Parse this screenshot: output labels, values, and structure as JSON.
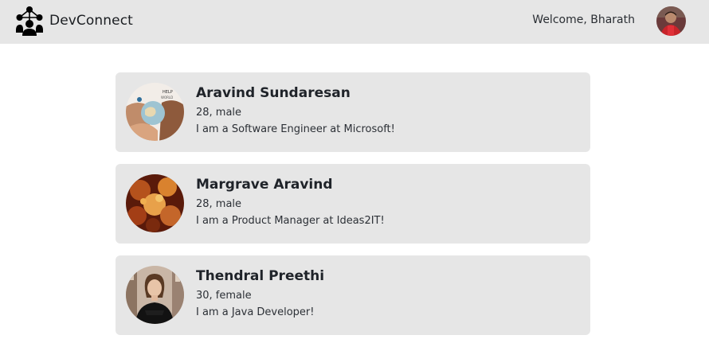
{
  "navbar": {
    "brand": "DevConnect",
    "welcome": "Welcome, Bharath",
    "logo_icon": "network-people-icon",
    "avatar_icon": "user-avatar"
  },
  "profiles": [
    {
      "name": "Aravind Sundaresan",
      "meta": "28, male",
      "bio": "I am a Software Engineer at Microsoft!",
      "avatar": "hands-globe-photo"
    },
    {
      "name": "Margrave Aravind",
      "meta": "28, male",
      "bio": "I am a Product Manager at Ideas2IT!",
      "avatar": "autumn-leaves-photo"
    },
    {
      "name": "Thendral Preethi",
      "meta": "30, female",
      "bio": "I am a Java Developer!",
      "avatar": "woman-portrait-photo"
    }
  ],
  "colors": {
    "navbar_bg": "#e6e6e6",
    "card_bg": "#e6e6e6",
    "text": "#1f2329",
    "page_bg": "#ffffff"
  }
}
